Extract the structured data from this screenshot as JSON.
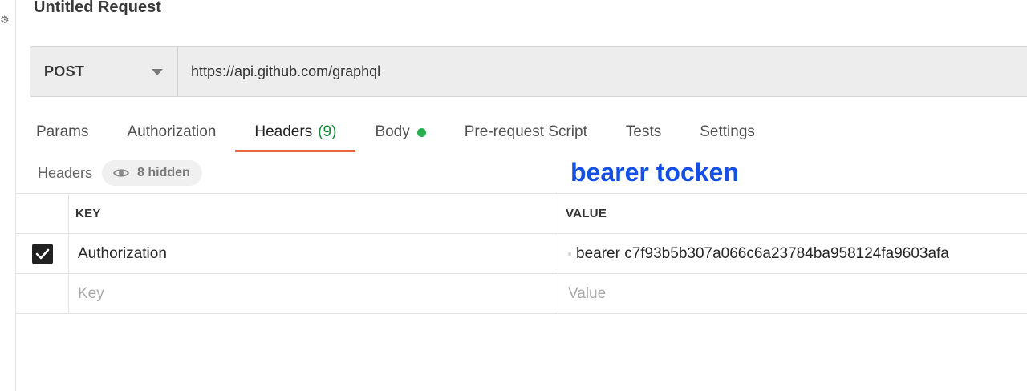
{
  "request": {
    "title": "Untitled Request",
    "method": "POST",
    "url": "https://api.github.com/graphql"
  },
  "tabs": [
    {
      "label": "Params"
    },
    {
      "label": "Authorization"
    },
    {
      "label": "Headers",
      "count": "(9)",
      "active": true
    },
    {
      "label": "Body",
      "indicator": "green-dot"
    },
    {
      "label": "Pre-request Script"
    },
    {
      "label": "Tests"
    },
    {
      "label": "Settings"
    }
  ],
  "headers_section": {
    "label": "Headers",
    "hidden_label": "8 hidden"
  },
  "annotation": {
    "text": "bearer tocken",
    "color": "#1450e6"
  },
  "table": {
    "columns": {
      "key": "KEY",
      "value": "VALUE"
    },
    "rows": [
      {
        "checked": true,
        "key": "Authorization",
        "value": "bearer c7f93b5b307a066c6a23784ba958124fa9603afa"
      }
    ],
    "new_row": {
      "key_placeholder": "Key",
      "value_placeholder": "Value"
    }
  },
  "colors": {
    "active_tab_underline": "#e8683f",
    "count_text": "#0f8a37",
    "body_indicator": "#26b04e"
  }
}
